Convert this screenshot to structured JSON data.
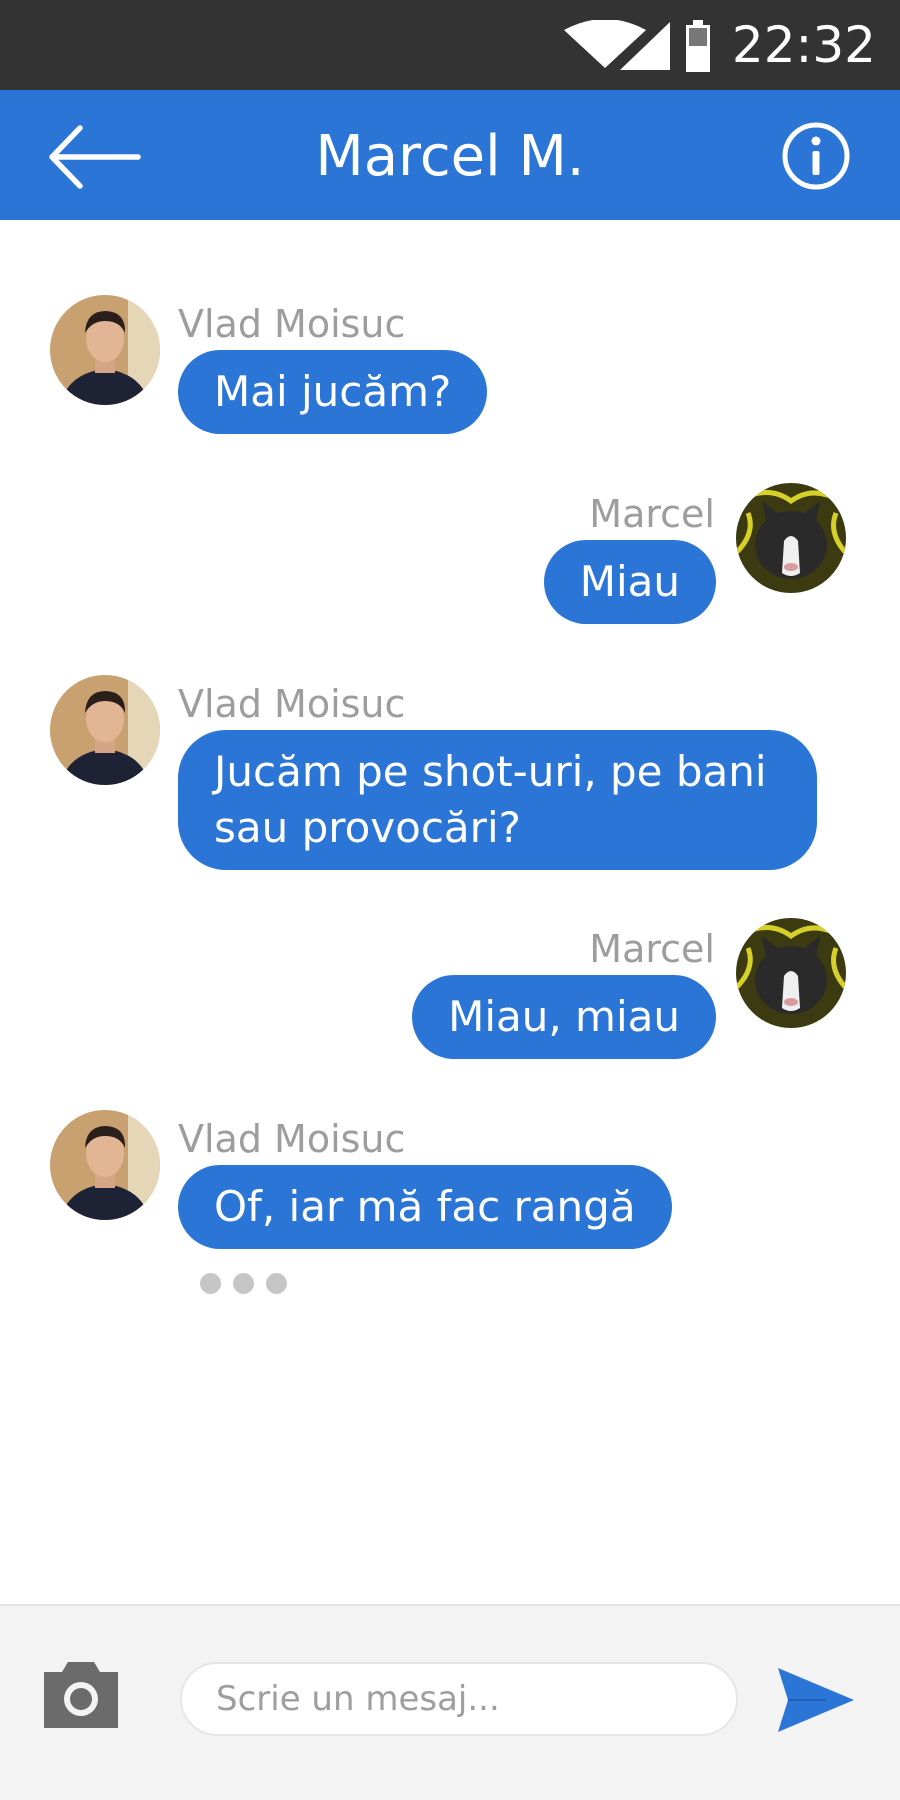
{
  "status_bar": {
    "time": "22:32",
    "icons": [
      "wifi-icon",
      "signal-icon",
      "battery-icon"
    ]
  },
  "header": {
    "title": "Marcel M.",
    "back_icon": "arrow-left-icon",
    "info_icon": "info-icon"
  },
  "messages": [
    {
      "sender": "Vlad Moisuc",
      "text": "Mai jucăm?",
      "side": "left"
    },
    {
      "sender": "Marcel",
      "text": "Miau",
      "side": "right"
    },
    {
      "sender": "Vlad Moisuc",
      "text": "Jucăm pe shot-uri, pe bani sau provocări?",
      "side": "left"
    },
    {
      "sender": "Marcel",
      "text": "Miau, miau",
      "side": "right"
    },
    {
      "sender": "Vlad Moisuc",
      "text": "Of, iar mă fac rangă",
      "side": "left"
    }
  ],
  "typing_indicator": true,
  "composer": {
    "placeholder": "Scrie un mesaj...",
    "value": "",
    "camera_icon": "camera-icon",
    "send_icon": "send-icon"
  },
  "colors": {
    "accent": "#2b75d6",
    "status_bar": "#333333",
    "sender_text": "#9d9d9d"
  }
}
